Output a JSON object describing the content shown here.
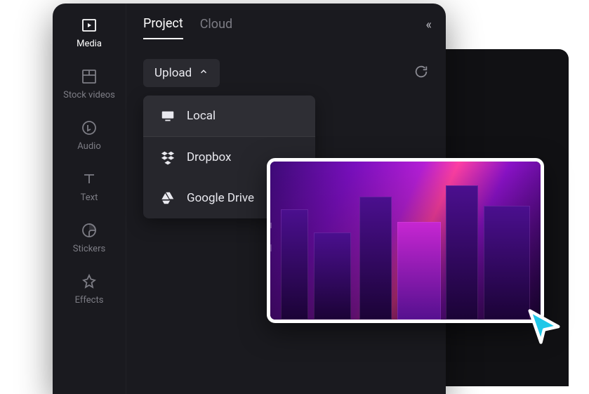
{
  "sidebar": {
    "items": [
      {
        "label": "Media",
        "icon": "media-icon",
        "active": true
      },
      {
        "label": "Stock videos",
        "icon": "stock-videos-icon",
        "active": false
      },
      {
        "label": "Audio",
        "icon": "audio-icon",
        "active": false
      },
      {
        "label": "Text",
        "icon": "text-icon",
        "active": false
      },
      {
        "label": "Stickers",
        "icon": "stickers-icon",
        "active": false
      },
      {
        "label": "Effects",
        "icon": "effects-icon",
        "active": false
      }
    ]
  },
  "panel": {
    "tabs": [
      {
        "label": "Project",
        "active": true
      },
      {
        "label": "Cloud",
        "active": false
      }
    ],
    "collapse_glyph": "«",
    "upload_button": {
      "label": "Upload"
    },
    "upload_menu": [
      {
        "label": "Local",
        "icon": "monitor-icon"
      },
      {
        "label": "Dropbox",
        "icon": "dropbox-icon"
      },
      {
        "label": "Google Drive",
        "icon": "google-drive-icon"
      }
    ]
  },
  "thumbnail": {
    "description": "neon-city-clip"
  },
  "colors": {
    "bg": "#1a1a1f",
    "panel_bg": "#26262c",
    "text_muted": "#7d7d85",
    "text": "#e9e9ef",
    "cursor": "#1fc7e8"
  }
}
